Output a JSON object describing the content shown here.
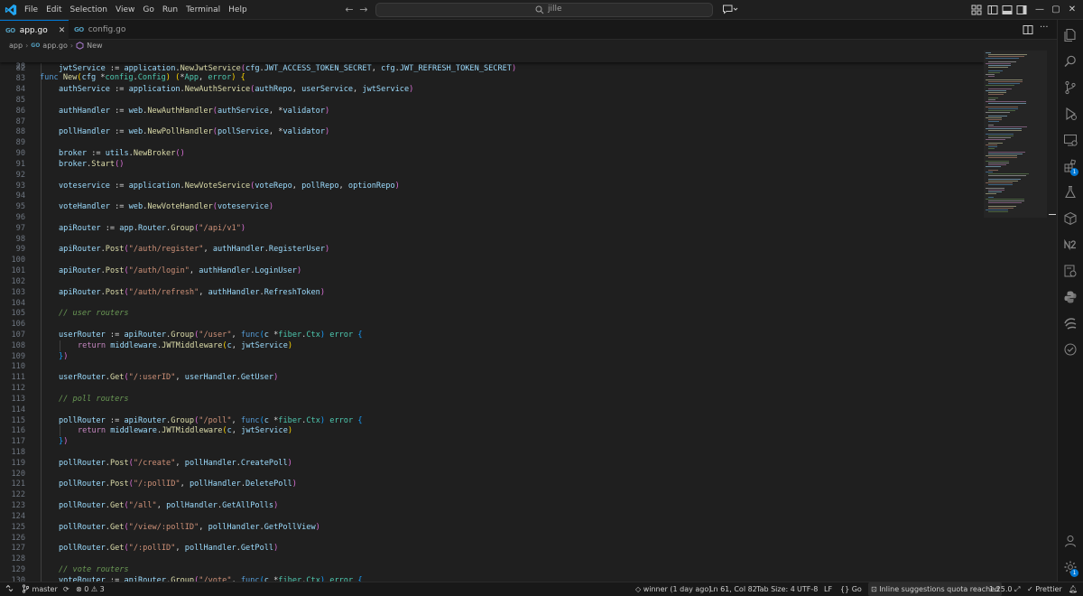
{
  "menu": [
    "File",
    "Edit",
    "Selection",
    "View",
    "Go",
    "Run",
    "Terminal",
    "Help"
  ],
  "command_center": {
    "text": "jille"
  },
  "tabs": [
    {
      "icon": "GO",
      "label": "app.go",
      "close": "✕"
    },
    {
      "icon": "GO",
      "label": "config.go"
    }
  ],
  "breadcrumb": {
    "folder": "app",
    "file_icon": "GO",
    "file": "app.go",
    "symbol": "New"
  },
  "sticky": {
    "line": "28",
    "code": [
      [
        "k",
        "func "
      ],
      [
        "f",
        "New"
      ],
      [
        "b1",
        "("
      ],
      [
        "v",
        "cfg "
      ],
      [
        "p",
        "*"
      ],
      [
        "t",
        "config"
      ],
      [
        "p",
        "."
      ],
      [
        "t",
        "Config"
      ],
      [
        "b1",
        ")"
      ],
      [
        "p",
        " "
      ],
      [
        "b1",
        "("
      ],
      [
        "p",
        "*"
      ],
      [
        "t",
        "App"
      ],
      [
        "p",
        ", "
      ],
      [
        "t",
        "error"
      ],
      [
        "b1",
        ")"
      ],
      [
        "p",
        " "
      ],
      [
        "b1",
        "{"
      ]
    ]
  },
  "code_lines": [
    {
      "n": "82",
      "indent": 1,
      "code": [
        [
          "v",
          "jwtService"
        ],
        [
          "p",
          " := "
        ],
        [
          "v",
          "application"
        ],
        [
          "p",
          "."
        ],
        [
          "f",
          "NewJwtService"
        ],
        [
          "b2",
          "("
        ],
        [
          "v",
          "cfg"
        ],
        [
          "p",
          "."
        ],
        [
          "v",
          "JWT_ACCESS_TOKEN_SECRET"
        ],
        [
          "p",
          ", "
        ],
        [
          "v",
          "cfg"
        ],
        [
          "p",
          "."
        ],
        [
          "v",
          "JWT_REFRESH_TOKEN_SECRET"
        ],
        [
          "b2",
          ")"
        ]
      ]
    },
    {
      "n": "83",
      "indent": 1,
      "code": []
    },
    {
      "n": "84",
      "indent": 1,
      "code": [
        [
          "v",
          "authService"
        ],
        [
          "p",
          " := "
        ],
        [
          "v",
          "application"
        ],
        [
          "p",
          "."
        ],
        [
          "f",
          "NewAuthService"
        ],
        [
          "b2",
          "("
        ],
        [
          "v",
          "authRepo"
        ],
        [
          "p",
          ", "
        ],
        [
          "v",
          "userService"
        ],
        [
          "p",
          ", "
        ],
        [
          "v",
          "jwtService"
        ],
        [
          "b2",
          ")"
        ]
      ]
    },
    {
      "n": "85",
      "indent": 1,
      "code": []
    },
    {
      "n": "86",
      "indent": 1,
      "code": [
        [
          "v",
          "authHandler"
        ],
        [
          "p",
          " := "
        ],
        [
          "v",
          "web"
        ],
        [
          "p",
          "."
        ],
        [
          "f",
          "NewAuthHandler"
        ],
        [
          "b2",
          "("
        ],
        [
          "v",
          "authService"
        ],
        [
          "p",
          ", "
        ],
        [
          "p",
          "*"
        ],
        [
          "v",
          "validator"
        ],
        [
          "b2",
          ")"
        ]
      ]
    },
    {
      "n": "87",
      "indent": 1,
      "code": []
    },
    {
      "n": "88",
      "indent": 1,
      "code": [
        [
          "v",
          "pollHandler"
        ],
        [
          "p",
          " := "
        ],
        [
          "v",
          "web"
        ],
        [
          "p",
          "."
        ],
        [
          "f",
          "NewPollHandler"
        ],
        [
          "b2",
          "("
        ],
        [
          "v",
          "pollService"
        ],
        [
          "p",
          ", "
        ],
        [
          "p",
          "*"
        ],
        [
          "v",
          "validator"
        ],
        [
          "b2",
          ")"
        ]
      ]
    },
    {
      "n": "89",
      "indent": 1,
      "code": []
    },
    {
      "n": "90",
      "indent": 1,
      "code": [
        [
          "v",
          "broker"
        ],
        [
          "p",
          " := "
        ],
        [
          "v",
          "utils"
        ],
        [
          "p",
          "."
        ],
        [
          "f",
          "NewBroker"
        ],
        [
          "b2",
          "()"
        ]
      ]
    },
    {
      "n": "91",
      "indent": 1,
      "code": [
        [
          "v",
          "broker"
        ],
        [
          "p",
          "."
        ],
        [
          "f",
          "Start"
        ],
        [
          "b2",
          "()"
        ]
      ]
    },
    {
      "n": "92",
      "indent": 1,
      "code": []
    },
    {
      "n": "93",
      "indent": 1,
      "code": [
        [
          "v",
          "voteservice"
        ],
        [
          "p",
          " := "
        ],
        [
          "v",
          "application"
        ],
        [
          "p",
          "."
        ],
        [
          "f",
          "NewVoteService"
        ],
        [
          "b2",
          "("
        ],
        [
          "v",
          "voteRepo"
        ],
        [
          "p",
          ", "
        ],
        [
          "v",
          "pollRepo"
        ],
        [
          "p",
          ", "
        ],
        [
          "v",
          "optionRepo"
        ],
        [
          "b2",
          ")"
        ]
      ]
    },
    {
      "n": "94",
      "indent": 1,
      "code": []
    },
    {
      "n": "95",
      "indent": 1,
      "code": [
        [
          "v",
          "voteHandler"
        ],
        [
          "p",
          " := "
        ],
        [
          "v",
          "web"
        ],
        [
          "p",
          "."
        ],
        [
          "f",
          "NewVoteHandler"
        ],
        [
          "b2",
          "("
        ],
        [
          "v",
          "voteservice"
        ],
        [
          "b2",
          ")"
        ]
      ]
    },
    {
      "n": "96",
      "indent": 1,
      "code": []
    },
    {
      "n": "97",
      "indent": 1,
      "code": [
        [
          "v",
          "apiRouter"
        ],
        [
          "p",
          " := "
        ],
        [
          "v",
          "app"
        ],
        [
          "p",
          "."
        ],
        [
          "v",
          "Router"
        ],
        [
          "p",
          "."
        ],
        [
          "f",
          "Group"
        ],
        [
          "b2",
          "("
        ],
        [
          "s",
          "\"/api/v1\""
        ],
        [
          "b2",
          ")"
        ]
      ]
    },
    {
      "n": "98",
      "indent": 1,
      "code": []
    },
    {
      "n": "99",
      "indent": 1,
      "code": [
        [
          "v",
          "apiRouter"
        ],
        [
          "p",
          "."
        ],
        [
          "f",
          "Post"
        ],
        [
          "b2",
          "("
        ],
        [
          "s",
          "\"/auth/register\""
        ],
        [
          "p",
          ", "
        ],
        [
          "v",
          "authHandler"
        ],
        [
          "p",
          "."
        ],
        [
          "v",
          "RegisterUser"
        ],
        [
          "b2",
          ")"
        ]
      ]
    },
    {
      "n": "100",
      "indent": 1,
      "code": []
    },
    {
      "n": "101",
      "indent": 1,
      "code": [
        [
          "v",
          "apiRouter"
        ],
        [
          "p",
          "."
        ],
        [
          "f",
          "Post"
        ],
        [
          "b2",
          "("
        ],
        [
          "s",
          "\"/auth/login\""
        ],
        [
          "p",
          ", "
        ],
        [
          "v",
          "authHandler"
        ],
        [
          "p",
          "."
        ],
        [
          "v",
          "LoginUser"
        ],
        [
          "b2",
          ")"
        ]
      ]
    },
    {
      "n": "102",
      "indent": 1,
      "code": []
    },
    {
      "n": "103",
      "indent": 1,
      "code": [
        [
          "v",
          "apiRouter"
        ],
        [
          "p",
          "."
        ],
        [
          "f",
          "Post"
        ],
        [
          "b2",
          "("
        ],
        [
          "s",
          "\"/auth/refresh\""
        ],
        [
          "p",
          ", "
        ],
        [
          "v",
          "authHandler"
        ],
        [
          "p",
          "."
        ],
        [
          "v",
          "RefreshToken"
        ],
        [
          "b2",
          ")"
        ]
      ]
    },
    {
      "n": "104",
      "indent": 1,
      "code": []
    },
    {
      "n": "105",
      "indent": 1,
      "code": [
        [
          "c",
          "// user routers"
        ]
      ]
    },
    {
      "n": "106",
      "indent": 1,
      "code": []
    },
    {
      "n": "107",
      "indent": 1,
      "code": [
        [
          "v",
          "userRouter"
        ],
        [
          "p",
          " := "
        ],
        [
          "v",
          "apiRouter"
        ],
        [
          "p",
          "."
        ],
        [
          "f",
          "Group"
        ],
        [
          "b2",
          "("
        ],
        [
          "s",
          "\"/user\""
        ],
        [
          "p",
          ", "
        ],
        [
          "k",
          "func"
        ],
        [
          "b3",
          "("
        ],
        [
          "v",
          "c "
        ],
        [
          "p",
          "*"
        ],
        [
          "t",
          "fiber"
        ],
        [
          "p",
          "."
        ],
        [
          "t",
          "Ctx"
        ],
        [
          "b3",
          ")"
        ],
        [
          "p",
          " "
        ],
        [
          "t",
          "error"
        ],
        [
          "p",
          " "
        ],
        [
          "b3",
          "{"
        ]
      ]
    },
    {
      "n": "108",
      "indent": 2,
      "code": [
        [
          "kw",
          "return "
        ],
        [
          "v",
          "middleware"
        ],
        [
          "p",
          "."
        ],
        [
          "f",
          "JWTMiddleware"
        ],
        [
          "b1",
          "("
        ],
        [
          "v",
          "c"
        ],
        [
          "p",
          ", "
        ],
        [
          "v",
          "jwtService"
        ],
        [
          "b1",
          ")"
        ]
      ]
    },
    {
      "n": "109",
      "indent": 1,
      "code": [
        [
          "b3",
          "}"
        ],
        [
          "b2",
          ")"
        ]
      ]
    },
    {
      "n": "110",
      "indent": 1,
      "code": []
    },
    {
      "n": "111",
      "indent": 1,
      "code": [
        [
          "v",
          "userRouter"
        ],
        [
          "p",
          "."
        ],
        [
          "f",
          "Get"
        ],
        [
          "b2",
          "("
        ],
        [
          "s",
          "\"/:userID\""
        ],
        [
          "p",
          ", "
        ],
        [
          "v",
          "userHandler"
        ],
        [
          "p",
          "."
        ],
        [
          "v",
          "GetUser"
        ],
        [
          "b2",
          ")"
        ]
      ]
    },
    {
      "n": "112",
      "indent": 1,
      "code": []
    },
    {
      "n": "113",
      "indent": 1,
      "code": [
        [
          "c",
          "// poll routers"
        ]
      ]
    },
    {
      "n": "114",
      "indent": 1,
      "code": []
    },
    {
      "n": "115",
      "indent": 1,
      "code": [
        [
          "v",
          "pollRouter"
        ],
        [
          "p",
          " := "
        ],
        [
          "v",
          "apiRouter"
        ],
        [
          "p",
          "."
        ],
        [
          "f",
          "Group"
        ],
        [
          "b2",
          "("
        ],
        [
          "s",
          "\"/poll\""
        ],
        [
          "p",
          ", "
        ],
        [
          "k",
          "func"
        ],
        [
          "b3",
          "("
        ],
        [
          "v",
          "c "
        ],
        [
          "p",
          "*"
        ],
        [
          "t",
          "fiber"
        ],
        [
          "p",
          "."
        ],
        [
          "t",
          "Ctx"
        ],
        [
          "b3",
          ")"
        ],
        [
          "p",
          " "
        ],
        [
          "t",
          "error"
        ],
        [
          "p",
          " "
        ],
        [
          "b3",
          "{"
        ]
      ]
    },
    {
      "n": "116",
      "indent": 2,
      "code": [
        [
          "kw",
          "return "
        ],
        [
          "v",
          "middleware"
        ],
        [
          "p",
          "."
        ],
        [
          "f",
          "JWTMiddleware"
        ],
        [
          "b1",
          "("
        ],
        [
          "v",
          "c"
        ],
        [
          "p",
          ", "
        ],
        [
          "v",
          "jwtService"
        ],
        [
          "b1",
          ")"
        ]
      ]
    },
    {
      "n": "117",
      "indent": 1,
      "code": [
        [
          "b3",
          "}"
        ],
        [
          "b2",
          ")"
        ]
      ]
    },
    {
      "n": "118",
      "indent": 1,
      "code": []
    },
    {
      "n": "119",
      "indent": 1,
      "code": [
        [
          "v",
          "pollRouter"
        ],
        [
          "p",
          "."
        ],
        [
          "f",
          "Post"
        ],
        [
          "b2",
          "("
        ],
        [
          "s",
          "\"/create\""
        ],
        [
          "p",
          ", "
        ],
        [
          "v",
          "pollHandler"
        ],
        [
          "p",
          "."
        ],
        [
          "v",
          "CreatePoll"
        ],
        [
          "b2",
          ")"
        ]
      ]
    },
    {
      "n": "120",
      "indent": 1,
      "code": []
    },
    {
      "n": "121",
      "indent": 1,
      "code": [
        [
          "v",
          "pollRouter"
        ],
        [
          "p",
          "."
        ],
        [
          "f",
          "Post"
        ],
        [
          "b2",
          "("
        ],
        [
          "s",
          "\"/:pollID\""
        ],
        [
          "p",
          ", "
        ],
        [
          "v",
          "pollHandler"
        ],
        [
          "p",
          "."
        ],
        [
          "v",
          "DeletePoll"
        ],
        [
          "b2",
          ")"
        ]
      ]
    },
    {
      "n": "122",
      "indent": 1,
      "code": []
    },
    {
      "n": "123",
      "indent": 1,
      "code": [
        [
          "v",
          "pollRouter"
        ],
        [
          "p",
          "."
        ],
        [
          "f",
          "Get"
        ],
        [
          "b2",
          "("
        ],
        [
          "s",
          "\"/all\""
        ],
        [
          "p",
          ", "
        ],
        [
          "v",
          "pollHandler"
        ],
        [
          "p",
          "."
        ],
        [
          "v",
          "GetAllPolls"
        ],
        [
          "b2",
          ")"
        ]
      ]
    },
    {
      "n": "124",
      "indent": 1,
      "code": []
    },
    {
      "n": "125",
      "indent": 1,
      "code": [
        [
          "v",
          "pollRouter"
        ],
        [
          "p",
          "."
        ],
        [
          "f",
          "Get"
        ],
        [
          "b2",
          "("
        ],
        [
          "s",
          "\"/view/:pollID\""
        ],
        [
          "p",
          ", "
        ],
        [
          "v",
          "pollHandler"
        ],
        [
          "p",
          "."
        ],
        [
          "v",
          "GetPollView"
        ],
        [
          "b2",
          ")"
        ]
      ]
    },
    {
      "n": "126",
      "indent": 1,
      "code": []
    },
    {
      "n": "127",
      "indent": 1,
      "code": [
        [
          "v",
          "pollRouter"
        ],
        [
          "p",
          "."
        ],
        [
          "f",
          "Get"
        ],
        [
          "b2",
          "("
        ],
        [
          "s",
          "\"/:pollID\""
        ],
        [
          "p",
          ", "
        ],
        [
          "v",
          "pollHandler"
        ],
        [
          "p",
          "."
        ],
        [
          "v",
          "GetPoll"
        ],
        [
          "b2",
          ")"
        ]
      ]
    },
    {
      "n": "128",
      "indent": 1,
      "code": []
    },
    {
      "n": "129",
      "indent": 1,
      "code": [
        [
          "c",
          "// vote routers"
        ]
      ]
    },
    {
      "n": "130",
      "indent": 1,
      "code": [
        [
          "v",
          "voteRouter"
        ],
        [
          "p",
          " := "
        ],
        [
          "v",
          "apiRouter"
        ],
        [
          "p",
          "."
        ],
        [
          "f",
          "Group"
        ],
        [
          "b2",
          "("
        ],
        [
          "s",
          "\"/vote\""
        ],
        [
          "p",
          ", "
        ],
        [
          "k",
          "func"
        ],
        [
          "b3",
          "("
        ],
        [
          "v",
          "c "
        ],
        [
          "p",
          "*"
        ],
        [
          "t",
          "fiber"
        ],
        [
          "p",
          "."
        ],
        [
          "t",
          "Ctx"
        ],
        [
          "b3",
          ")"
        ],
        [
          "p",
          " "
        ],
        [
          "t",
          "error"
        ],
        [
          "p",
          " "
        ],
        [
          "b3",
          "{"
        ]
      ]
    }
  ],
  "status": {
    "branch": "master",
    "errors": "0",
    "warnings": "3",
    "blame": "winner (1 day ago)",
    "cursor": "Ln 61, Col 82",
    "tab_size": "Tab Size: 4",
    "encoding": "UTF-8",
    "eol": "LF",
    "language": "Go",
    "copilot": "Inline suggestions quota reached",
    "go_version": "1.25.0",
    "prettier": "Prettier"
  },
  "badges": {
    "extensions": "1",
    "accounts": "1"
  },
  "colors": {
    "accent": "#0078d4",
    "editor_bg": "#1f1f1f",
    "chrome_bg": "#181818",
    "go_icon": "#519aba"
  }
}
